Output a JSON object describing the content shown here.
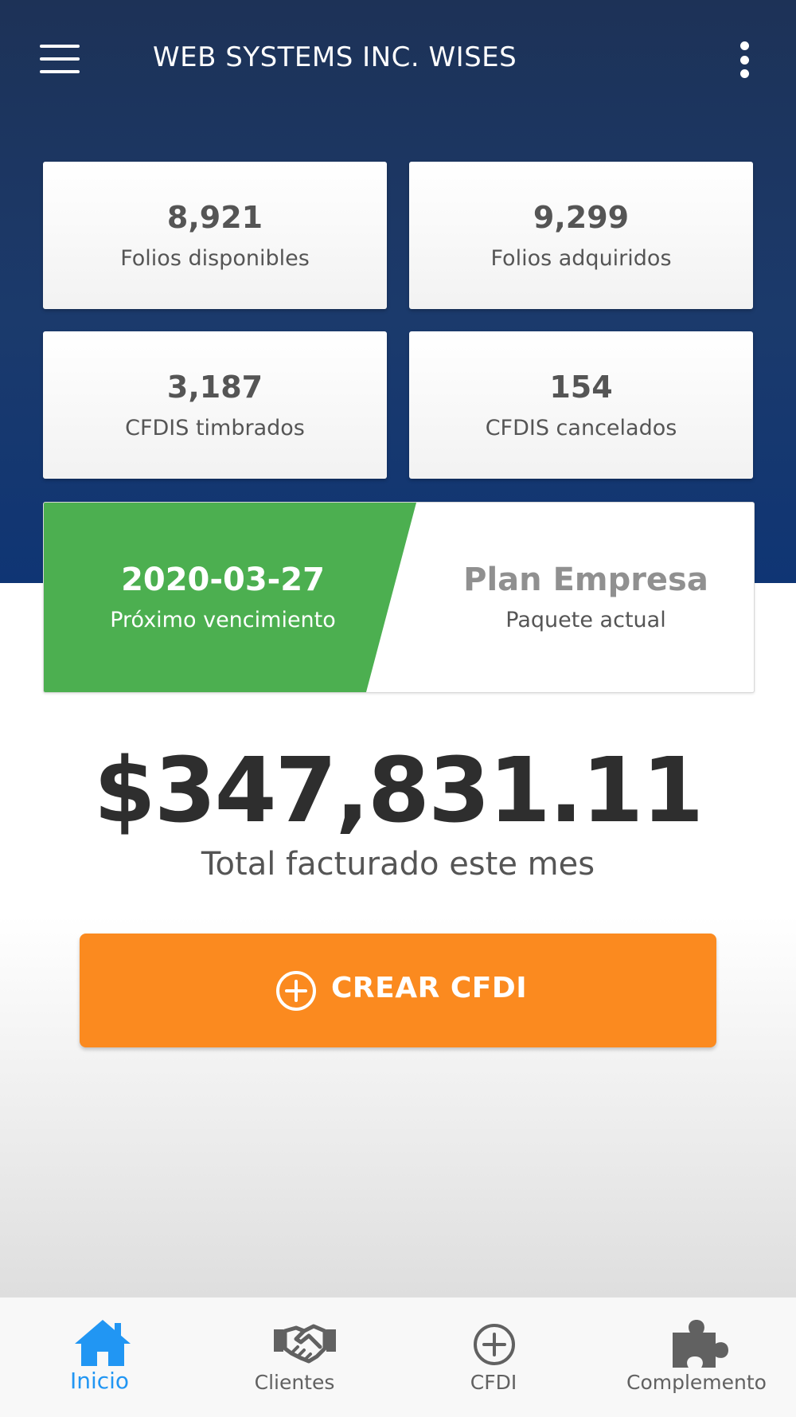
{
  "app": {
    "title": "WEB SYSTEMS INC. WISES"
  },
  "stats": [
    {
      "value": "8,921",
      "label": "Folios disponibles"
    },
    {
      "value": "9,299",
      "label": "Folios adquiridos"
    },
    {
      "value": "3,187",
      "label": "CFDIS timbrados"
    },
    {
      "value": "154",
      "label": "CFDIS cancelados"
    }
  ],
  "plan": {
    "expiry_date": "2020-03-27",
    "expiry_label": "Próximo vencimiento",
    "name": "Plan Empresa",
    "name_label": "Paquete actual"
  },
  "total": {
    "amount": "$347,831.11",
    "label": "Total facturado este mes"
  },
  "create_button": {
    "label": "CREAR CFDI"
  },
  "bottom_nav": {
    "items": [
      {
        "label": "Inicio",
        "icon": "home-icon",
        "active": true
      },
      {
        "label": "Clientes",
        "icon": "handshake-icon",
        "active": false
      },
      {
        "label": "CFDI",
        "icon": "plus-circle-icon",
        "active": false
      },
      {
        "label": "Complemento",
        "icon": "puzzle-icon",
        "active": false
      }
    ]
  },
  "colors": {
    "header": "#1d3257",
    "accent_green": "#4caf50",
    "accent_orange": "#fb8a1f",
    "nav_active": "#2196f3",
    "nav_inactive": "#616161"
  }
}
